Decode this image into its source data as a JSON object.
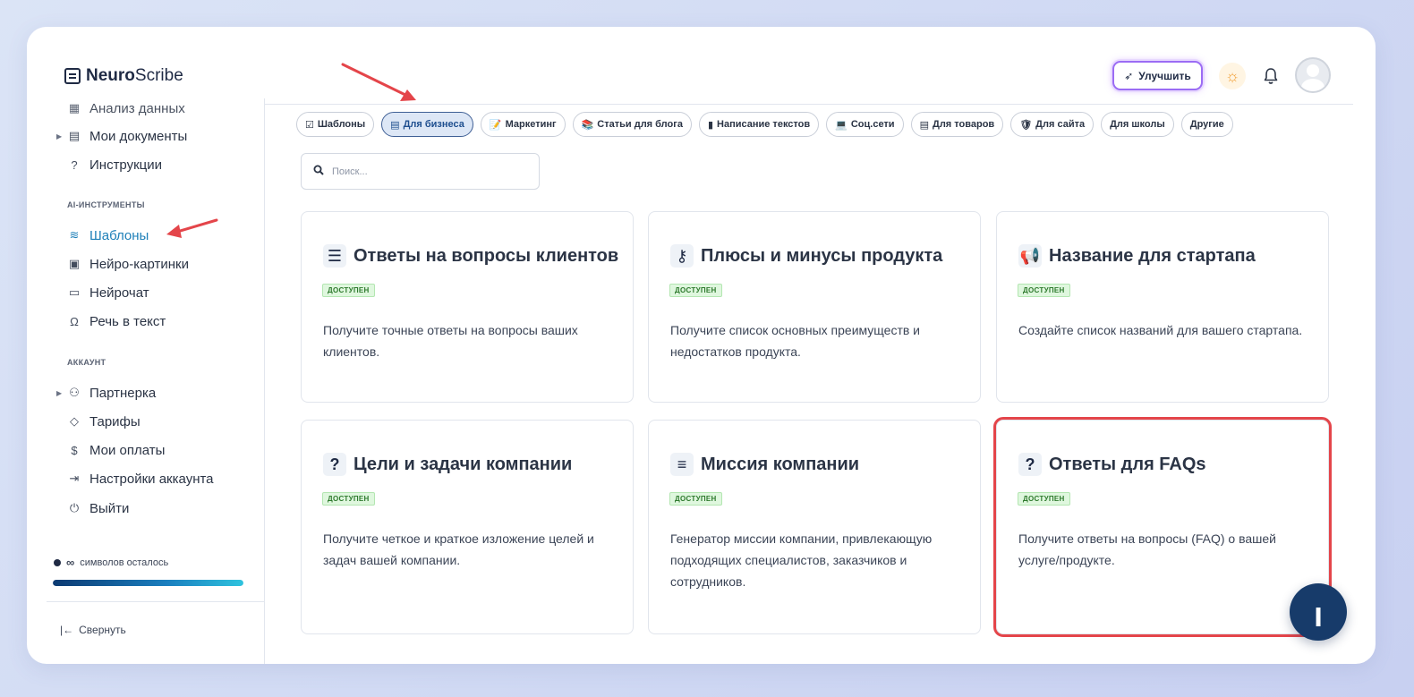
{
  "app": {
    "brand_bold": "Neuro",
    "brand_light": "Scribe",
    "upgrade_label": "Улучшить"
  },
  "sidebar": {
    "items_top": [
      {
        "label": "Анализ данных",
        "icon": "chart-icon"
      },
      {
        "label": "Мои документы",
        "icon": "document-icon"
      },
      {
        "label": "Инструкции",
        "icon": "help-circle-icon"
      }
    ],
    "section_ai": "AI-ИНСТРУМЕНТЫ",
    "items_ai": [
      {
        "label": "Шаблоны",
        "icon": "layers-icon"
      },
      {
        "label": "Нейро-картинки",
        "icon": "image-icon"
      },
      {
        "label": "Нейрочат",
        "icon": "chat-icon"
      },
      {
        "label": "Речь в текст",
        "icon": "headphones-icon"
      }
    ],
    "section_account": "АККАУНТ",
    "items_account": [
      {
        "label": "Партнерка",
        "icon": "users-icon"
      },
      {
        "label": "Тарифы",
        "icon": "tag-icon"
      },
      {
        "label": "Мои оплаты",
        "icon": "dollar-icon"
      },
      {
        "label": "Настройки аккаунта",
        "icon": "settings-arrow-icon"
      },
      {
        "label": "Выйти",
        "icon": "power-icon"
      }
    ],
    "credits_symbol": "∞",
    "credits_label": "символов осталось",
    "credits_fill": 1.0,
    "collapse_label": "Свернуть"
  },
  "chips": [
    {
      "label": "Шаблоны",
      "icon": "☑"
    },
    {
      "label": "Для бизнеса",
      "icon": "▤"
    },
    {
      "label": "Маркетинг",
      "icon": "📝"
    },
    {
      "label": "Статьи для блога",
      "icon": "📚"
    },
    {
      "label": "Написание текстов",
      "icon": "▮"
    },
    {
      "label": "Соц.сети",
      "icon": "💻"
    },
    {
      "label": "Для товаров",
      "icon": "▤"
    },
    {
      "label": "Для сайта",
      "icon": "🛡"
    },
    {
      "label": "Для школы",
      "icon": ""
    },
    {
      "label": "Другие",
      "icon": ""
    }
  ],
  "active_chip": "Для бизнеса",
  "search": {
    "placeholder": "Поиск..."
  },
  "badge_label": "ДОСТУПЕН",
  "cards": [
    {
      "title": "Ответы на вопросы клиентов",
      "icon": "list-icon",
      "desc": "Получите точные ответы на вопросы ваших клиентов."
    },
    {
      "title": "Плюсы и минусы продукта",
      "icon": "key-icon",
      "desc": "Получите список основных преимуществ и недостатков продукта."
    },
    {
      "title": "Название для стартапа",
      "icon": "megaphone-icon",
      "desc": "Создайте список названий для вашего стартапа."
    },
    {
      "title": "Цели и задачи компании",
      "icon": "question-icon",
      "desc": "Получите четкое и краткое изложение целей и задач вашей компании."
    },
    {
      "title": "Миссия компании",
      "icon": "text-lines-icon",
      "desc": "Генератор миссии компании, привлекающую подходящих специалистов, заказчиков и сотрудников."
    },
    {
      "title": "Ответы для FAQs",
      "icon": "question-icon",
      "desc": "Получите ответы на вопросы (FAQ) о вашей услуге/продукте."
    }
  ],
  "colors": {
    "accent_active": "#1d7fb8",
    "highlight": "#e4454a",
    "badge_bg": "#dff7de",
    "fab": "#173b6a"
  }
}
